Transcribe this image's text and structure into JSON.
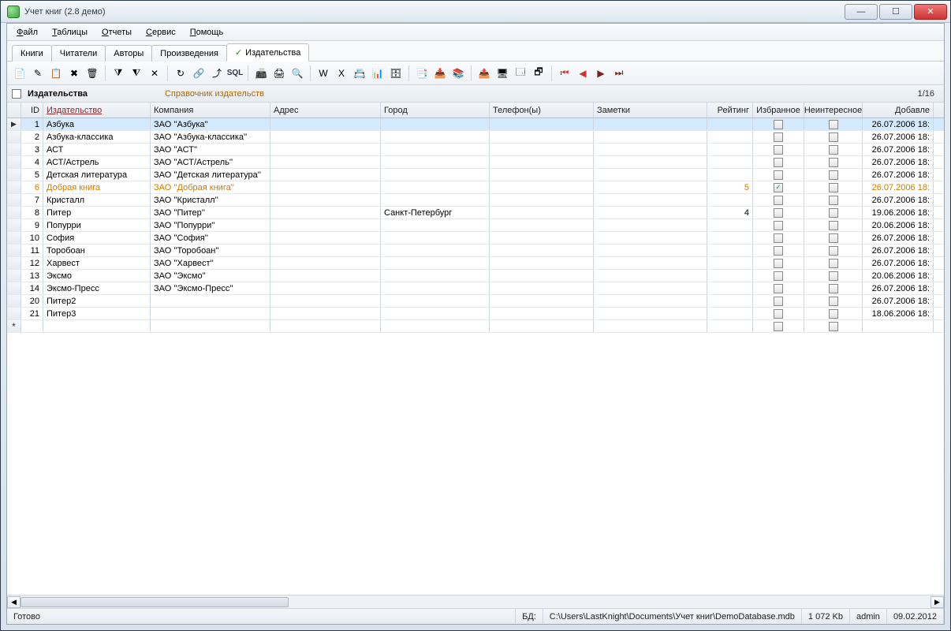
{
  "window": {
    "title": "Учет книг (2.8 демо)"
  },
  "menubar": [
    {
      "label": "Файл",
      "u": 0
    },
    {
      "label": "Таблицы",
      "u": 0
    },
    {
      "label": "Отчеты",
      "u": 0
    },
    {
      "label": "Сервис",
      "u": 0
    },
    {
      "label": "Помощь",
      "u": 0
    }
  ],
  "tabs": [
    {
      "label": "Книги"
    },
    {
      "label": "Читатели"
    },
    {
      "label": "Авторы"
    },
    {
      "label": "Произведения"
    },
    {
      "label": "Издательства",
      "active": true,
      "check": true
    }
  ],
  "toolbar_groups": [
    [
      "📄",
      "✎",
      "📋",
      "✖",
      "🗑"
    ],
    [
      "⧩",
      "⧨",
      "✕"
    ],
    [
      "↻",
      "🔗",
      "⤴",
      "SQL"
    ],
    [
      "📠",
      "🖨",
      "🔍"
    ],
    [
      "W",
      "X",
      "📇",
      "📊",
      "🗄"
    ],
    [
      "📑",
      "📥",
      "📚"
    ],
    [
      "📤",
      "🖥",
      "🗔",
      "🗗"
    ],
    [
      "⏮",
      "◀",
      "▶",
      "⏭"
    ]
  ],
  "section": {
    "title": "Издательства",
    "subtitle": "Справочник издательств",
    "counter": "1/16"
  },
  "columns": [
    {
      "key": "id",
      "label": "ID",
      "cls": "c-id right"
    },
    {
      "key": "publisher",
      "label": "Издательство",
      "cls": "c-pub",
      "link": true
    },
    {
      "key": "company",
      "label": "Компания",
      "cls": "c-comp"
    },
    {
      "key": "address",
      "label": "Адрес",
      "cls": "c-addr"
    },
    {
      "key": "city",
      "label": "Город",
      "cls": "c-city"
    },
    {
      "key": "phone",
      "label": "Телефон(ы)",
      "cls": "c-tel"
    },
    {
      "key": "notes",
      "label": "Заметки",
      "cls": "c-notes"
    },
    {
      "key": "rating",
      "label": "Рейтинг",
      "cls": "c-rate right"
    },
    {
      "key": "favorite",
      "label": "Избранное",
      "cls": "c-fav center",
      "check": true
    },
    {
      "key": "uninteresting",
      "label": "Неинтересное",
      "cls": "c-unint center",
      "check": true
    },
    {
      "key": "added",
      "label": "Добавле",
      "cls": "c-added right"
    }
  ],
  "rows": [
    {
      "id": "1",
      "publisher": "Азбука",
      "company": "ЗАО ''Азбука''",
      "added": "26.07.2006 18:",
      "selected": true
    },
    {
      "id": "2",
      "publisher": "Азбука-классика",
      "company": "ЗАО ''Азбука-классика''",
      "added": "26.07.2006 18:"
    },
    {
      "id": "3",
      "publisher": "АСТ",
      "company": "ЗАО ''АСТ''",
      "added": "26.07.2006 18:"
    },
    {
      "id": "4",
      "publisher": "АСТ/Астрель",
      "company": "ЗАО ''АСТ/Астрель''",
      "added": "26.07.2006 18:"
    },
    {
      "id": "5",
      "publisher": "Детская литература",
      "company": "ЗАО ''Детская литература''",
      "added": "26.07.2006 18:"
    },
    {
      "id": "6",
      "publisher": "Добрая книга",
      "company": "ЗАО ''Добрая книга''",
      "rating": "5",
      "favorite": true,
      "added": "26.07.2006 18:",
      "favrow": true
    },
    {
      "id": "7",
      "publisher": "Кристалл",
      "company": "ЗАО ''Кристалл''",
      "added": "26.07.2006 18:"
    },
    {
      "id": "8",
      "publisher": "Питер",
      "company": "ЗАО ''Питер''",
      "city": "Санкт-Петербург",
      "rating": "4",
      "added": "19.06.2006 18:"
    },
    {
      "id": "9",
      "publisher": "Попурри",
      "company": "ЗАО ''Попурри''",
      "added": "20.06.2006 18:"
    },
    {
      "id": "10",
      "publisher": "София",
      "company": "ЗАО ''София''",
      "added": "26.07.2006 18:"
    },
    {
      "id": "11",
      "publisher": "Торобоан",
      "company": "ЗАО ''Торобоан''",
      "added": "26.07.2006 18:"
    },
    {
      "id": "12",
      "publisher": "Харвест",
      "company": "ЗАО ''Харвест''",
      "added": "26.07.2006 18:"
    },
    {
      "id": "13",
      "publisher": "Эксмо",
      "company": "ЗАО ''Эксмо''",
      "added": "20.06.2006 18:"
    },
    {
      "id": "14",
      "publisher": "Эксмо-Пресс",
      "company": "ЗАО ''Эксмо-Пресс''",
      "added": "26.07.2006 18:"
    },
    {
      "id": "20",
      "publisher": "Питер2",
      "company": "",
      "added": "26.07.2006 18:"
    },
    {
      "id": "21",
      "publisher": "Питер3",
      "company": "",
      "added": "18.06.2006 18:"
    }
  ],
  "statusbar": {
    "ready": "Готово",
    "db_label": "БД:",
    "db_path": "C:\\Users\\LastKnight\\Documents\\Учет книг\\DemoDatabase.mdb",
    "size": "1 072 Kb",
    "user": "admin",
    "date": "09.02.2012"
  }
}
